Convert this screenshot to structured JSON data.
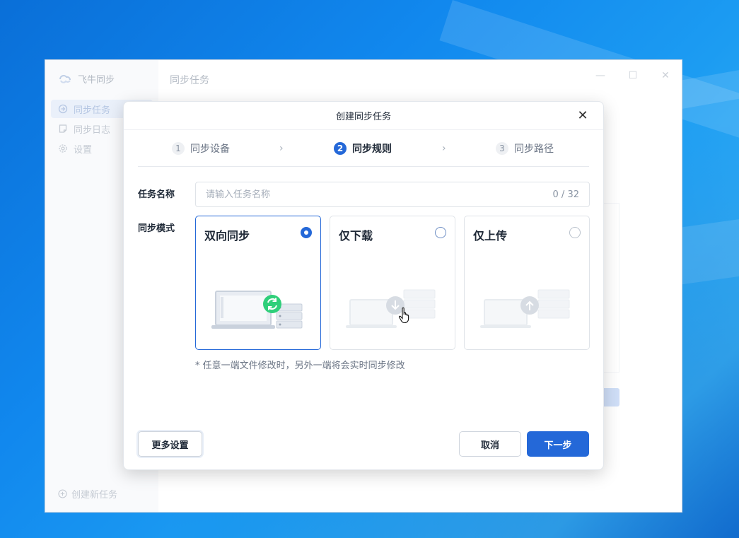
{
  "app": {
    "name": "飞牛同步",
    "main_title": "同步任务",
    "create_new": "创建新任务",
    "nav": [
      {
        "label": "同步任务",
        "active": true
      },
      {
        "label": "同步日志",
        "active": false
      },
      {
        "label": "设置",
        "active": false
      }
    ],
    "window_controls": {
      "minimize": "—",
      "maximize": "☐",
      "close": "✕"
    }
  },
  "dialog": {
    "title": "创建同步任务",
    "close_glyph": "✕",
    "steps": [
      {
        "num": "1",
        "label": "同步设备",
        "active": false
      },
      {
        "num": "2",
        "label": "同步规则",
        "active": true
      },
      {
        "num": "3",
        "label": "同步路径",
        "active": false
      }
    ],
    "chevron": "›",
    "task_name_label": "任务名称",
    "task_name_value": "",
    "task_name_placeholder": "请输入任务名称",
    "task_name_counter": "0 / 32",
    "sync_mode_label": "同步模式",
    "modes": [
      {
        "title": "双向同步",
        "selected": true
      },
      {
        "title": "仅下载",
        "selected": false
      },
      {
        "title": "仅上传",
        "selected": false
      }
    ],
    "mode_hint": "* 任意一端文件修改时，另外一端将会实时同步修改",
    "more_settings": "更多设置",
    "cancel": "取消",
    "next": "下一步"
  },
  "colors": {
    "accent": "#2468d8",
    "sync_green": "#2fcf7a",
    "desktop": "#1188ee"
  },
  "icons": [
    "app-logo-icon",
    "sync-task-icon",
    "log-icon",
    "gear-icon",
    "plus-circle-icon",
    "close-icon",
    "chevron-right-icon",
    "sync-arrows-icon",
    "download-arrow-icon",
    "upload-arrow-icon",
    "hand-cursor-icon"
  ]
}
